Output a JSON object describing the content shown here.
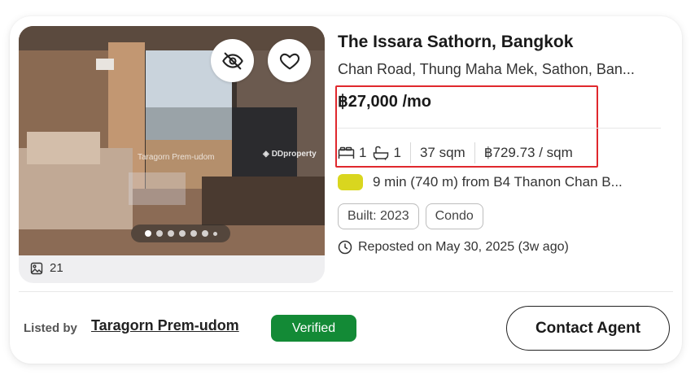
{
  "listing": {
    "title": "The Issara Sathorn, Bangkok",
    "address": "Chan Road, Thung Maha Mek, Sathon, Ban...",
    "price": "฿27,000 /mo",
    "bedrooms": "1",
    "bathrooms": "1",
    "area": "37 sqm",
    "price_per_sqm": "฿729.73 / sqm",
    "transit": "9 min (740 m) from B4 Thanon Chan B...",
    "transit_badge_color": "#d9d61f",
    "tags": [
      "Built: 2023",
      "Condo"
    ],
    "reposted": "Reposted on May 30, 2025 (3w ago)"
  },
  "media": {
    "photo_count": "21",
    "watermark_left": "Taragorn Prem-udom",
    "watermark_right": "DDproperty",
    "carousel": {
      "total_dots": 7,
      "active_index": 0
    },
    "icons": [
      "hide-eye-icon",
      "heart-icon",
      "photo-icon"
    ]
  },
  "footer": {
    "listed_by_label": "Listed by",
    "agent_name": "Taragorn Prem-udom",
    "verified_label": "Verified",
    "contact_label": "Contact Agent"
  },
  "colors": {
    "verified_bg": "#138a36",
    "highlight_border": "#e0282d"
  }
}
